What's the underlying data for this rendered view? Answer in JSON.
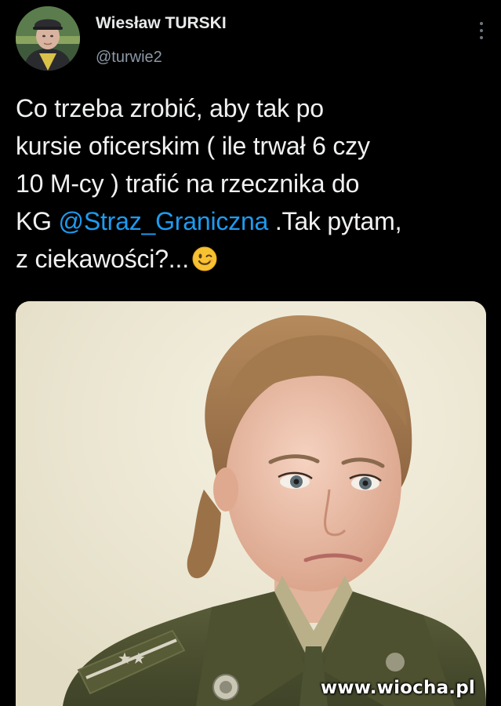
{
  "tweet": {
    "author_name": "Wiesław TURSKI",
    "author_handle": "@turwie2",
    "text_lines": [
      "Co trzeba zrobić, aby tak po",
      "kursie oficerskim ( ile trwał 6 czy",
      "10 M-cy ) trafić na rzecznika do",
      "KG ",
      " .Tak pytam,",
      "z ciekawości?..."
    ],
    "mention": "@Straz_Graniczna",
    "emoji": "winking-face-emoji"
  },
  "media": {
    "description_icon": "photo",
    "watermark": "www.wiocha.pl"
  },
  "colors": {
    "background": "#000000",
    "text": "#e7e9ea",
    "handle": "#8b98a5",
    "mention": "#1d9bf0"
  }
}
